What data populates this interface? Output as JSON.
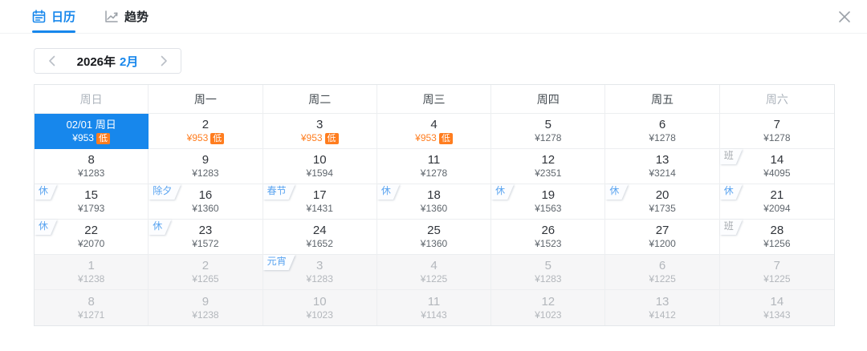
{
  "tabs": {
    "calendar": {
      "label": "日历"
    },
    "trend": {
      "label": "趋势"
    }
  },
  "month_nav": {
    "year": "2026年",
    "month": "2月"
  },
  "weekday_headers": [
    {
      "label": "周日",
      "muted": true
    },
    {
      "label": "周一",
      "muted": false
    },
    {
      "label": "周二",
      "muted": false
    },
    {
      "label": "周三",
      "muted": false
    },
    {
      "label": "周四",
      "muted": false
    },
    {
      "label": "周五",
      "muted": false
    },
    {
      "label": "周六",
      "muted": true
    }
  ],
  "low_badge_label": "低",
  "colors": {
    "accent_blue": "#1787ec",
    "price_orange": "#ff7d1f",
    "holiday_tag_blue": "#5aa4f0",
    "work_tag_gray": "#a3a8ad"
  },
  "calendar_rows": [
    [
      {
        "day": "02/01 周日",
        "price": "¥953",
        "low": true,
        "selected": true
      },
      {
        "day": "2",
        "price": "¥953",
        "low": true
      },
      {
        "day": "3",
        "price": "¥953",
        "low": true
      },
      {
        "day": "4",
        "price": "¥953",
        "low": true
      },
      {
        "day": "5",
        "price": "¥1278"
      },
      {
        "day": "6",
        "price": "¥1278"
      },
      {
        "day": "7",
        "price": "¥1278"
      }
    ],
    [
      {
        "day": "8",
        "price": "¥1283"
      },
      {
        "day": "9",
        "price": "¥1283"
      },
      {
        "day": "10",
        "price": "¥1594"
      },
      {
        "day": "11",
        "price": "¥1278"
      },
      {
        "day": "12",
        "price": "¥2351"
      },
      {
        "day": "13",
        "price": "¥3214"
      },
      {
        "day": "14",
        "price": "¥4095",
        "tag": "班",
        "tag_type": "work"
      }
    ],
    [
      {
        "day": "15",
        "price": "¥1793",
        "tag": "休",
        "tag_type": "holiday"
      },
      {
        "day": "16",
        "price": "¥1360",
        "tag": "除夕",
        "tag_type": "holiday"
      },
      {
        "day": "17",
        "price": "¥1431",
        "tag": "春节",
        "tag_type": "holiday"
      },
      {
        "day": "18",
        "price": "¥1360",
        "tag": "休",
        "tag_type": "holiday"
      },
      {
        "day": "19",
        "price": "¥1563",
        "tag": "休",
        "tag_type": "holiday"
      },
      {
        "day": "20",
        "price": "¥1735",
        "tag": "休",
        "tag_type": "holiday"
      },
      {
        "day": "21",
        "price": "¥2094",
        "tag": "休",
        "tag_type": "holiday"
      }
    ],
    [
      {
        "day": "22",
        "price": "¥2070",
        "tag": "休",
        "tag_type": "holiday"
      },
      {
        "day": "23",
        "price": "¥1572",
        "tag": "休",
        "tag_type": "holiday"
      },
      {
        "day": "24",
        "price": "¥1652"
      },
      {
        "day": "25",
        "price": "¥1360"
      },
      {
        "day": "26",
        "price": "¥1523"
      },
      {
        "day": "27",
        "price": "¥1200"
      },
      {
        "day": "28",
        "price": "¥1256",
        "tag": "班",
        "tag_type": "work"
      }
    ],
    [
      {
        "day": "1",
        "price": "¥1238",
        "muted": true
      },
      {
        "day": "2",
        "price": "¥1265",
        "muted": true
      },
      {
        "day": "3",
        "price": "¥1283",
        "muted": true,
        "tag": "元宵",
        "tag_type": "holiday"
      },
      {
        "day": "4",
        "price": "¥1225",
        "muted": true
      },
      {
        "day": "5",
        "price": "¥1283",
        "muted": true
      },
      {
        "day": "6",
        "price": "¥1225",
        "muted": true
      },
      {
        "day": "7",
        "price": "¥1225",
        "muted": true
      }
    ],
    [
      {
        "day": "8",
        "price": "¥1271",
        "muted": true
      },
      {
        "day": "9",
        "price": "¥1238",
        "muted": true
      },
      {
        "day": "10",
        "price": "¥1023",
        "muted": true
      },
      {
        "day": "11",
        "price": "¥1143",
        "muted": true
      },
      {
        "day": "12",
        "price": "¥1023",
        "muted": true
      },
      {
        "day": "13",
        "price": "¥1412",
        "muted": true
      },
      {
        "day": "14",
        "price": "¥1343",
        "muted": true
      }
    ]
  ]
}
